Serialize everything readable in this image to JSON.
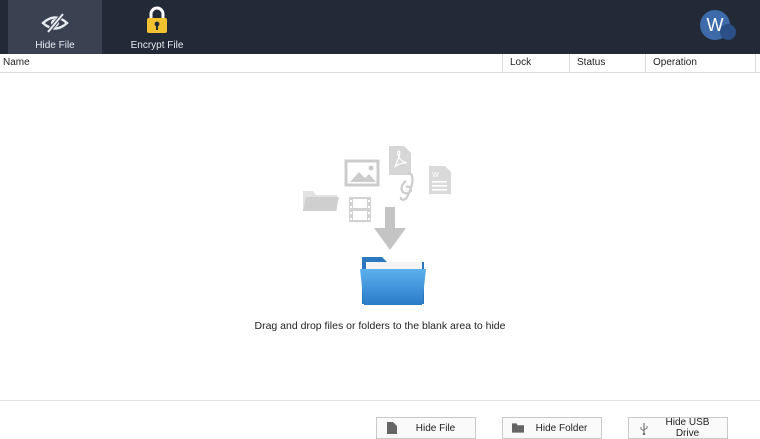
{
  "toolbar": {
    "tabs": [
      {
        "label": "Hide File",
        "icon": "eye-hidden-icon",
        "active": true
      },
      {
        "label": "Encrypt File",
        "icon": "lock-icon",
        "active": false
      }
    ],
    "avatar_letter": "W"
  },
  "table": {
    "columns": [
      "Name",
      "Lock",
      "Status",
      "Operation"
    ]
  },
  "drop_area": {
    "hint": "Drag and drop files or folders to the blank area to hide"
  },
  "actions": {
    "hide_file_label": "Hide File",
    "hide_folder_label": "Hide Folder",
    "hide_usb_label": "Hide USB Drive"
  },
  "colors": {
    "topbar_bg": "#222a38",
    "active_tab_bg": "#3a4252",
    "folder_blue": "#3b8fd6",
    "lock_gold": "#f2c230"
  }
}
